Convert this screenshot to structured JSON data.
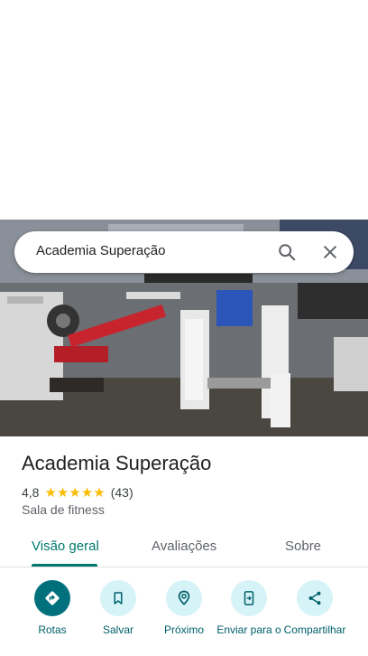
{
  "search": {
    "query": "Academia Superação",
    "search_icon": "search-icon",
    "close_icon": "close-icon"
  },
  "place": {
    "name": "Academia Superação",
    "rating": "4,8",
    "stars": 5,
    "review_count": "(43)",
    "category": "Sala de fitness"
  },
  "tabs": [
    {
      "label": "Visão geral",
      "active": true
    },
    {
      "label": "Avaliações",
      "active": false
    },
    {
      "label": "Sobre",
      "active": false
    }
  ],
  "actions": [
    {
      "label": "Rotas",
      "icon": "directions-icon"
    },
    {
      "label": "Salvar",
      "icon": "bookmark-icon"
    },
    {
      "label": "Próximo",
      "icon": "nearby-icon"
    },
    {
      "label": "Enviar para o",
      "icon": "send-to-phone-icon"
    },
    {
      "label": "Compartilhar",
      "icon": "share-icon"
    }
  ],
  "colors": {
    "accent": "#00796b",
    "action_bg": "#d6f3f8",
    "action_primary": "#00707c",
    "star": "#fbbc04"
  }
}
